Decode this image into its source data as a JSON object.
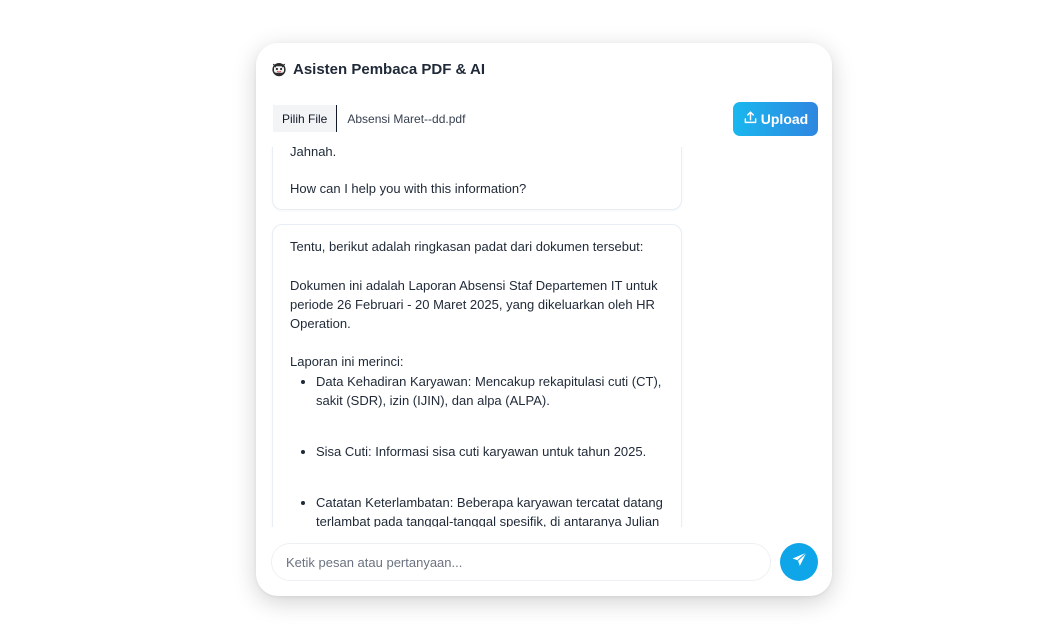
{
  "app": {
    "title": "Asisten Pembaca PDF & AI",
    "logo_icon": "robot-mascot-icon"
  },
  "file": {
    "pick_label": "Pilih File",
    "selected_name": "Absensi Maret--dd.pdf"
  },
  "upload": {
    "label": "Upload",
    "icon": "upload-icon"
  },
  "messages": [
    {
      "lines": [
        "Jahnah.",
        "How can I help you with this information?"
      ]
    },
    {
      "intro": "Tentu, berikut adalah ringkasan padat dari dokumen tersebut:",
      "summary": "Dokumen ini adalah Laporan Absensi Staf Departemen IT untuk periode 26 Februari - 20 Maret 2025, yang dikeluarkan oleh HR Operation.",
      "list_intro": "Laporan ini merinci:",
      "items": [
        "Data Kehadiran Karyawan: Mencakup rekapitulasi cuti (CT), sakit (SDR), izin (IJIN), dan alpa (ALPA).",
        "Sisa Cuti: Informasi sisa cuti karyawan untuk tahun 2025.",
        "Catatan Keterlambatan: Beberapa karyawan tercatat datang terlambat pada tanggal-tanggal spesifik, di antaranya Julian"
      ]
    }
  ],
  "composer": {
    "placeholder": "Ketik pesan atau pertanyaan...",
    "send_icon": "send-icon"
  },
  "colors": {
    "accent": "#0ea5e9",
    "upload_gradient_start": "#19b7ef",
    "upload_gradient_end": "#2f86e0"
  }
}
